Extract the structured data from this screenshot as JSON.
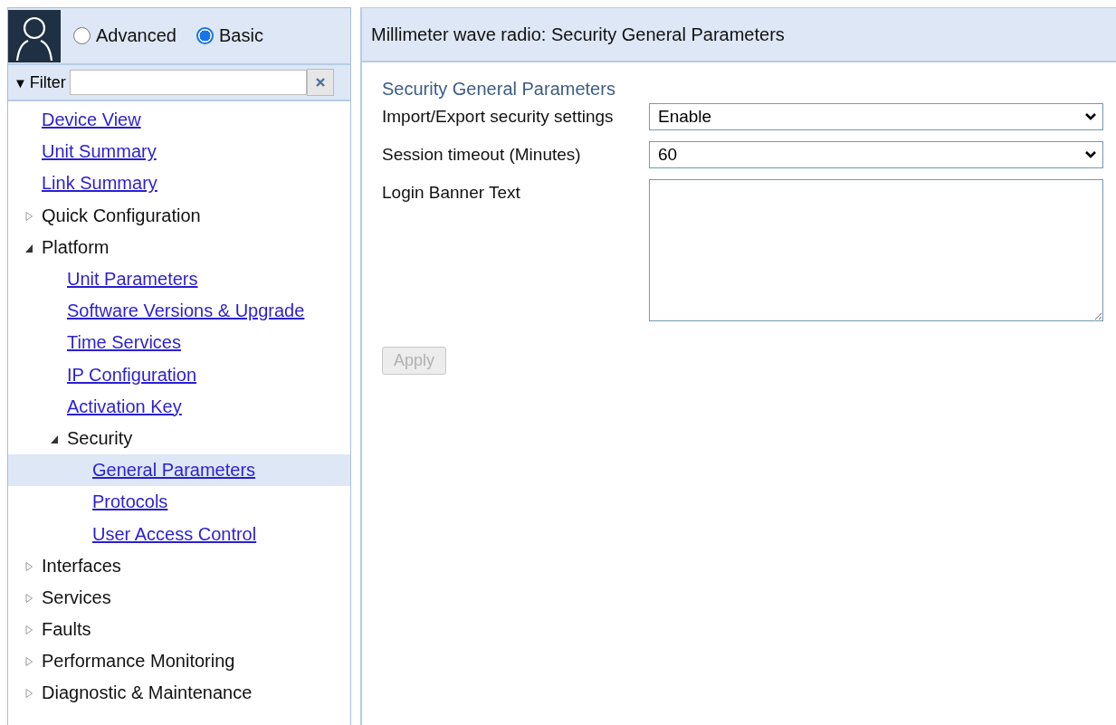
{
  "sidebar": {
    "mode_options": [
      {
        "label": "Advanced",
        "selected": false
      },
      {
        "label": "Basic",
        "selected": true
      }
    ],
    "filter": {
      "toggle": "▼",
      "label": "Filter"
    },
    "tree": [
      {
        "kind": "link",
        "label": "Device View",
        "selected": false
      },
      {
        "kind": "link",
        "label": "Unit Summary",
        "selected": false
      },
      {
        "kind": "link",
        "label": "Link Summary",
        "selected": false
      },
      {
        "kind": "group",
        "label": "Quick Configuration",
        "expanded": false
      },
      {
        "kind": "group",
        "label": "Platform",
        "expanded": true,
        "children": [
          {
            "kind": "link",
            "label": "Unit Parameters",
            "selected": false
          },
          {
            "kind": "link",
            "label": "Software Versions & Upgrade",
            "selected": false
          },
          {
            "kind": "link",
            "label": "Time Services",
            "selected": false
          },
          {
            "kind": "link",
            "label": "IP Configuration",
            "selected": false
          },
          {
            "kind": "link",
            "label": "Activation Key",
            "selected": false
          },
          {
            "kind": "group",
            "label": "Security",
            "expanded": true,
            "children": [
              {
                "kind": "link",
                "label": "General Parameters",
                "selected": true
              },
              {
                "kind": "link",
                "label": "Protocols",
                "selected": false
              },
              {
                "kind": "link",
                "label": "User Access Control",
                "selected": false
              }
            ]
          }
        ]
      },
      {
        "kind": "group",
        "label": "Interfaces",
        "expanded": false
      },
      {
        "kind": "group",
        "label": "Services",
        "expanded": false
      },
      {
        "kind": "group",
        "label": "Faults",
        "expanded": false
      },
      {
        "kind": "group",
        "label": "Performance Monitoring",
        "expanded": false
      },
      {
        "kind": "group",
        "label": "Diagnostic & Maintenance",
        "expanded": false
      }
    ]
  },
  "main": {
    "title": "Millimeter wave radio: Security General Parameters",
    "section_title": "Security General Parameters",
    "fields": [
      {
        "kind": "select",
        "label": "Import/Export security settings",
        "value": "Enable"
      },
      {
        "kind": "select",
        "label": "Session timeout (Minutes)",
        "value": "60"
      },
      {
        "kind": "textarea",
        "label": "Login Banner Text"
      }
    ],
    "apply_button": {
      "label": "Apply",
      "disabled": true
    }
  }
}
